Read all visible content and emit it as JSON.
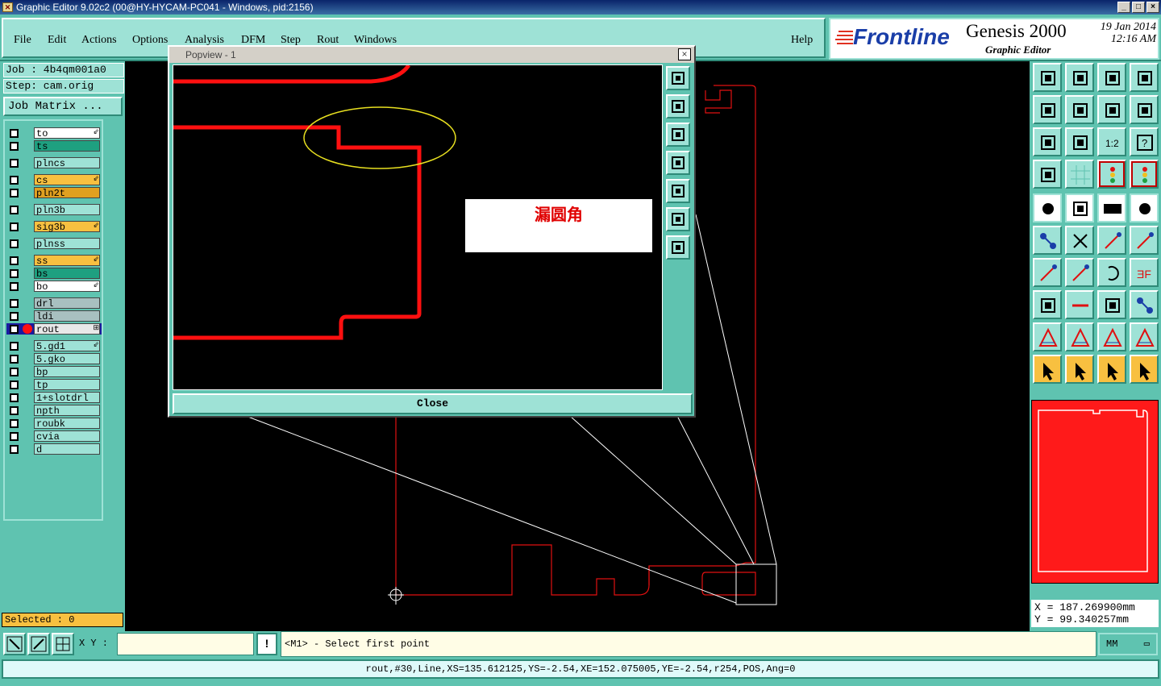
{
  "window": {
    "title": "Graphic Editor 9.02c2 (00@HY-HYCAM-PC041 - Windows, pid:2156)",
    "min": "_",
    "max": "□",
    "close": "×"
  },
  "menu": {
    "file": "File",
    "edit": "Edit",
    "actions": "Actions",
    "options": "Options",
    "analysis": "Analysis",
    "dfm": "DFM",
    "step": "Step",
    "rout": "Rout",
    "windows": "Windows",
    "help": "Help"
  },
  "brand": {
    "logo": "Frontline",
    "product": "Genesis 2000",
    "subtitle": "Graphic Editor",
    "date": "19 Jan 2014",
    "time": "12:16 AM"
  },
  "job": {
    "job_label": "Job : 4b4qm001a0",
    "step_label": "Step: cam.orig",
    "matrix_button": "Job Matrix ..."
  },
  "layers": [
    {
      "name": "to",
      "color": "#ffffff",
      "mark": "⇙"
    },
    {
      "name": "ts",
      "color": "#1ea080",
      "mark": ""
    },
    {
      "name": "plncs",
      "color": "#9ee2d6",
      "mark": ""
    },
    {
      "name": "cs",
      "color": "#f8c040",
      "mark": "⇙"
    },
    {
      "name": "pln2t",
      "color": "#e0a020",
      "mark": ""
    },
    {
      "name": "pln3b",
      "color": "#9ee2d6",
      "mark": ""
    },
    {
      "name": "sig3b",
      "color": "#f8c040",
      "mark": "⇙"
    },
    {
      "name": "plnss",
      "color": "#9ee2d6",
      "mark": ""
    },
    {
      "name": "ss",
      "color": "#f8c040",
      "mark": "⇙"
    },
    {
      "name": "bs",
      "color": "#1ea080",
      "mark": ""
    },
    {
      "name": "bo",
      "color": "#ffffff",
      "mark": "⇙"
    },
    {
      "name": "drl",
      "color": "#a8c0c0",
      "mark": ""
    },
    {
      "name": "ldi",
      "color": "#a8c0c0",
      "mark": ""
    },
    {
      "name": "rout",
      "color": "#e8e8e8",
      "mark": "⊞"
    },
    {
      "name": "5.gd1",
      "color": "#9ee2d6",
      "mark": "⇙"
    },
    {
      "name": "5.gko",
      "color": "#9ee2d6",
      "mark": ""
    },
    {
      "name": "bp",
      "color": "#9ee2d6",
      "mark": ""
    },
    {
      "name": "tp",
      "color": "#9ee2d6",
      "mark": ""
    },
    {
      "name": "1+slotdrl",
      "color": "#9ee2d6",
      "mark": ""
    },
    {
      "name": "npth",
      "color": "#9ee2d6",
      "mark": ""
    },
    {
      "name": "roubk",
      "color": "#9ee2d6",
      "mark": ""
    },
    {
      "name": "cvia",
      "color": "#9ee2d6",
      "mark": ""
    },
    {
      "name": "d",
      "color": "#9ee2d6",
      "mark": ""
    }
  ],
  "selected": "Selected : 0",
  "popup": {
    "title": "Popview - 1",
    "close_x": "×",
    "close_button": "Close",
    "annotation": "漏圆角"
  },
  "coords": {
    "x": "X  =  187.269900mm",
    "y": "Y  =  99.340257mm"
  },
  "bottom": {
    "xy_label": "X Y :",
    "xy_value": "",
    "bang": "!",
    "prompt": "<M1> - Select first point",
    "unit": "MM",
    "unit_arrow": "▭",
    "status": "rout,#30,Line,XS=135.612125,YS=-2.54,XE=152.075005,YE=-2.54,r254,POS,Ang=0"
  },
  "colors": {
    "panel": "#5fc3b0",
    "accent": "#9ee2d6",
    "trace": "#ff1a1a"
  }
}
